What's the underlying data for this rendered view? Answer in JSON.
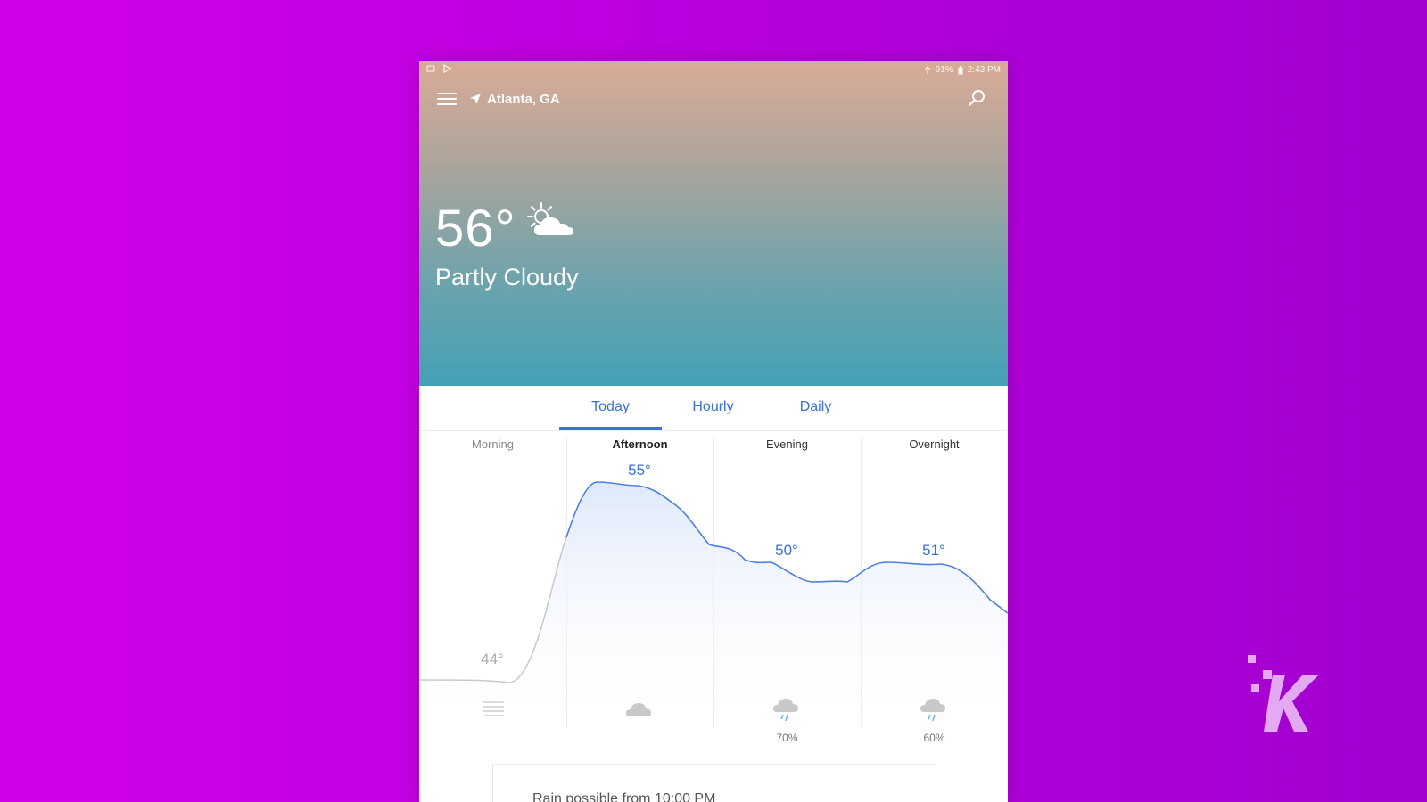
{
  "colors": {
    "accent": "#3a6fd8",
    "background_left": "#d100e8",
    "background_right": "#a000d0",
    "hero_top": "#d9ab96",
    "hero_bottom": "#44a1b6",
    "logo": "#e3a9f2"
  },
  "status_bar": {
    "left_icons": [
      "notification-icon",
      "play-store-icon"
    ],
    "battery": "91%",
    "time": "2:43 PM"
  },
  "header": {
    "location": "Atlanta, GA",
    "icons": [
      "menu-icon",
      "location-arrow-icon",
      "search-icon"
    ]
  },
  "current": {
    "temperature": "56°",
    "condition": "Partly Cloudy",
    "icon": "partly-cloudy-icon"
  },
  "tabs": [
    {
      "label": "Today",
      "active": true
    },
    {
      "label": "Hourly",
      "active": false
    },
    {
      "label": "Daily",
      "active": false
    }
  ],
  "periods": [
    {
      "label": "Morning",
      "temperature": "44°",
      "icon": "fog-icon",
      "precip": ""
    },
    {
      "label": "Afternoon",
      "temperature": "55°",
      "icon": "cloud-icon",
      "precip": ""
    },
    {
      "label": "Evening",
      "temperature": "50°",
      "icon": "rain-cloud-icon",
      "precip": "70%"
    },
    {
      "label": "Overnight",
      "temperature": "51°",
      "icon": "rain-cloud-icon",
      "precip": "60%"
    }
  ],
  "alert": {
    "text": "Rain possible from 10:00 PM"
  }
}
